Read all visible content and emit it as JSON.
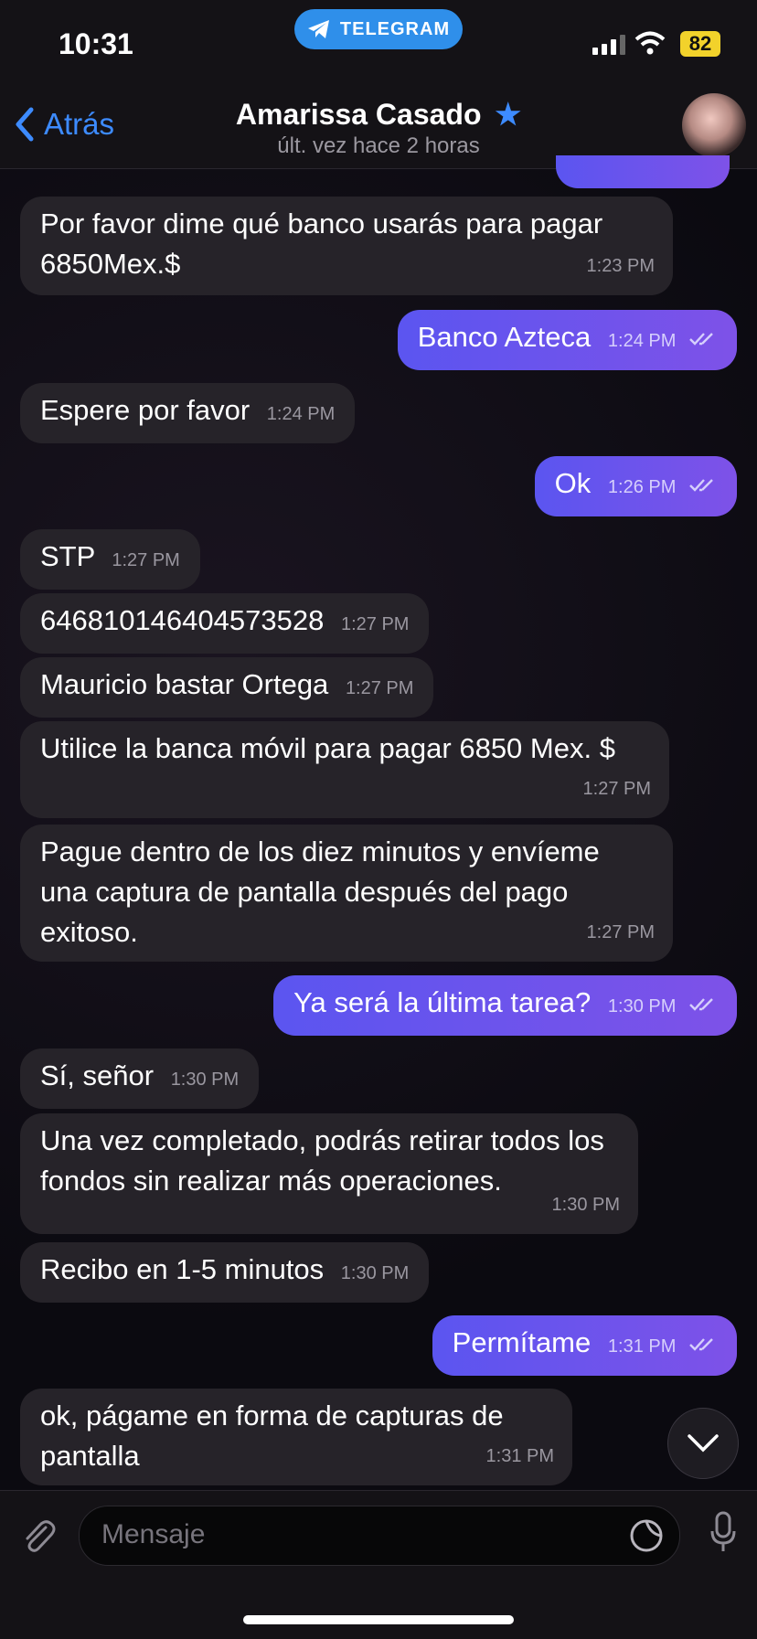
{
  "status_bar": {
    "time": "10:31",
    "app_pill": "TELEGRAM",
    "battery": "82"
  },
  "header": {
    "back_label": "Atrás",
    "name": "Amarissa Casado",
    "subtitle": "últ. vez hace 2 horas"
  },
  "messages": [
    {
      "dir": "in",
      "text": "Por favor dime qué banco usarás para pagar 6850Mex.$",
      "time": "1:23 PM"
    },
    {
      "dir": "out",
      "text": "Banco Azteca",
      "time": "1:24 PM"
    },
    {
      "dir": "in",
      "text": "Espere por favor",
      "time": "1:24 PM"
    },
    {
      "dir": "out",
      "text": "Ok",
      "time": "1:26 PM"
    },
    {
      "dir": "in",
      "text": "STP",
      "time": "1:27 PM"
    },
    {
      "dir": "in",
      "text": "646810146404573528",
      "time": "1:27 PM"
    },
    {
      "dir": "in",
      "text": "Mauricio bastar Ortega",
      "time": "1:27 PM"
    },
    {
      "dir": "in",
      "text": "Utilice la banca móvil para pagar 6850 Mex. $",
      "time": "1:27 PM"
    },
    {
      "dir": "in",
      "text": "Pague dentro de los diez minutos y envíeme una captura de pantalla después del pago exitoso.",
      "time": "1:27 PM"
    },
    {
      "dir": "out",
      "text": "Ya será la última tarea?",
      "time": "1:30 PM"
    },
    {
      "dir": "in",
      "text": "Sí, señor",
      "time": "1:30 PM"
    },
    {
      "dir": "in",
      "text": "Una vez completado, podrás retirar todos los fondos sin realizar más operaciones.",
      "time": "1:30 PM"
    },
    {
      "dir": "in",
      "text": "Recibo en 1-5 minutos",
      "time": "1:30 PM"
    },
    {
      "dir": "out",
      "text": "Permítame",
      "time": "1:31 PM"
    },
    {
      "dir": "in",
      "text": "ok, págame en forma de capturas de pantalla",
      "time": "1:31 PM"
    }
  ],
  "composer": {
    "placeholder": "Mensaje"
  },
  "colors": {
    "accent": "#3d8bff",
    "out_bubble_start": "#5b55f0",
    "out_bubble_end": "#7e52e8",
    "in_bubble": "#262329",
    "battery": "#f2d22b"
  }
}
